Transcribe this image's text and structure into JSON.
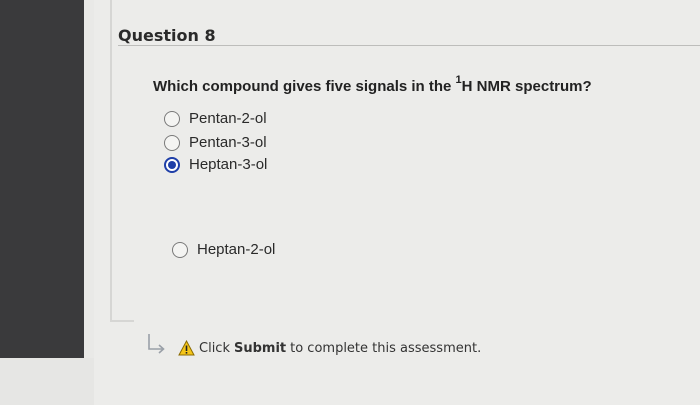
{
  "question": {
    "title": "Question 8",
    "prompt_before": "Which compound gives five signals in the ",
    "prompt_sup": "1",
    "prompt_after": "H NMR spectrum?"
  },
  "options": [
    {
      "label": "Pentan-2-ol",
      "selected": false
    },
    {
      "label": "Pentan-3-ol",
      "selected": false
    },
    {
      "label": "Heptan-3-ol",
      "selected": true
    },
    {
      "label": "Heptan-2-ol",
      "selected": false
    }
  ],
  "notice": {
    "prefix": "Click",
    "action": "Submit",
    "suffix": "to complete this assessment."
  },
  "icons": {
    "arrow": "turn-arrow-icon",
    "warning": "warning-icon"
  },
  "colors": {
    "selected_radio": "#1f3fa8",
    "warning_fill": "#f5c518"
  }
}
